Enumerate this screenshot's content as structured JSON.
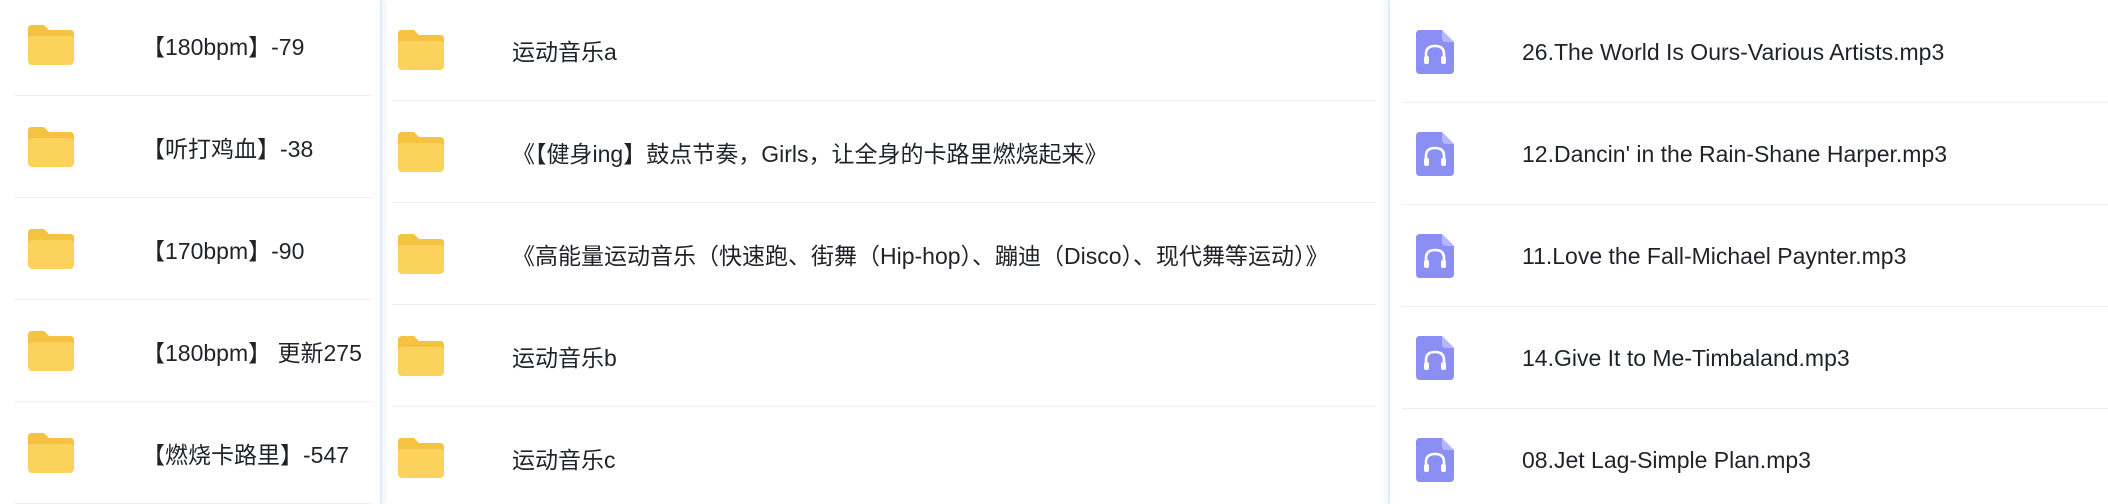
{
  "colors": {
    "folder": "#fbd35c",
    "folder_back": "#f5c242",
    "audio_icon": "#8b8ff4",
    "text": "#1f2329",
    "divider": "#eef0f3"
  },
  "panes": {
    "left": {
      "items": [
        {
          "label": "【180bpm】-79",
          "icon": "folder-icon"
        },
        {
          "label": "【听打鸡血】-38",
          "icon": "folder-icon"
        },
        {
          "label": "【170bpm】-90",
          "icon": "folder-icon"
        },
        {
          "label": "【180bpm】 更新275",
          "icon": "folder-icon"
        },
        {
          "label": "【燃烧卡路里】-547",
          "icon": "folder-icon"
        }
      ]
    },
    "middle": {
      "items": [
        {
          "label": "运动音乐a",
          "icon": "folder-icon"
        },
        {
          "label": "《【健身ing】鼓点节奏，Girls，让全身的卡路里燃烧起来》",
          "icon": "folder-icon"
        },
        {
          "label": "《高能量运动音乐（快速跑、街舞（Hip-hop）、蹦迪（Disco）、现代舞等运动）》",
          "icon": "folder-icon"
        },
        {
          "label": "运动音乐b",
          "icon": "folder-icon"
        },
        {
          "label": "运动音乐c",
          "icon": "folder-icon"
        }
      ]
    },
    "right": {
      "items": [
        {
          "label": "26.The World Is Ours-Various Artists.mp3",
          "icon": "audio-file-icon"
        },
        {
          "label": "12.Dancin' in the Rain-Shane Harper.mp3",
          "icon": "audio-file-icon"
        },
        {
          "label": "11.Love the Fall-Michael Paynter.mp3",
          "icon": "audio-file-icon"
        },
        {
          "label": "14.Give It to Me-Timbaland.mp3",
          "icon": "audio-file-icon"
        },
        {
          "label": "08.Jet Lag-Simple Plan.mp3",
          "icon": "audio-file-icon"
        }
      ]
    }
  }
}
